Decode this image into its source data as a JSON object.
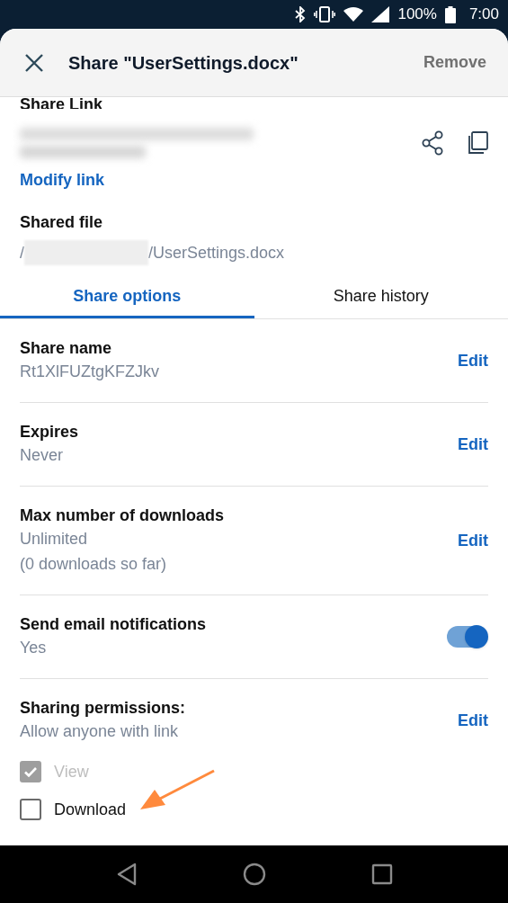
{
  "status_bar": {
    "battery": "100%",
    "time": "7:00"
  },
  "header": {
    "title": "Share \"UserSettings.docx\"",
    "action": "Remove"
  },
  "share_link": {
    "label": "Share Link",
    "modify": "Modify link"
  },
  "shared_file": {
    "label": "Shared file",
    "path_prefix": "/",
    "path_suffix": "/UserSettings.docx"
  },
  "tabs": [
    {
      "label": "Share options",
      "selected": true
    },
    {
      "label": "Share history",
      "selected": false
    }
  ],
  "settings": [
    {
      "kind": "edit",
      "label": "Share name",
      "values": [
        "Rt1XlFUZtgKFZJkv"
      ],
      "action": "Edit"
    },
    {
      "kind": "edit",
      "label": "Expires",
      "values": [
        "Never"
      ],
      "action": "Edit"
    },
    {
      "kind": "edit",
      "label": "Max number of downloads",
      "values": [
        "Unlimited",
        "(0 downloads so far)"
      ],
      "action": "Edit"
    },
    {
      "kind": "toggle",
      "label": "Send email notifications",
      "values": [
        "Yes"
      ],
      "on": true
    }
  ],
  "permissions": {
    "label": "Sharing permissions:",
    "value": "Allow anyone with link",
    "action": "Edit",
    "options": [
      {
        "label": "View",
        "checked": true,
        "disabled": true
      },
      {
        "label": "Download",
        "checked": false,
        "disabled": false
      }
    ]
  }
}
